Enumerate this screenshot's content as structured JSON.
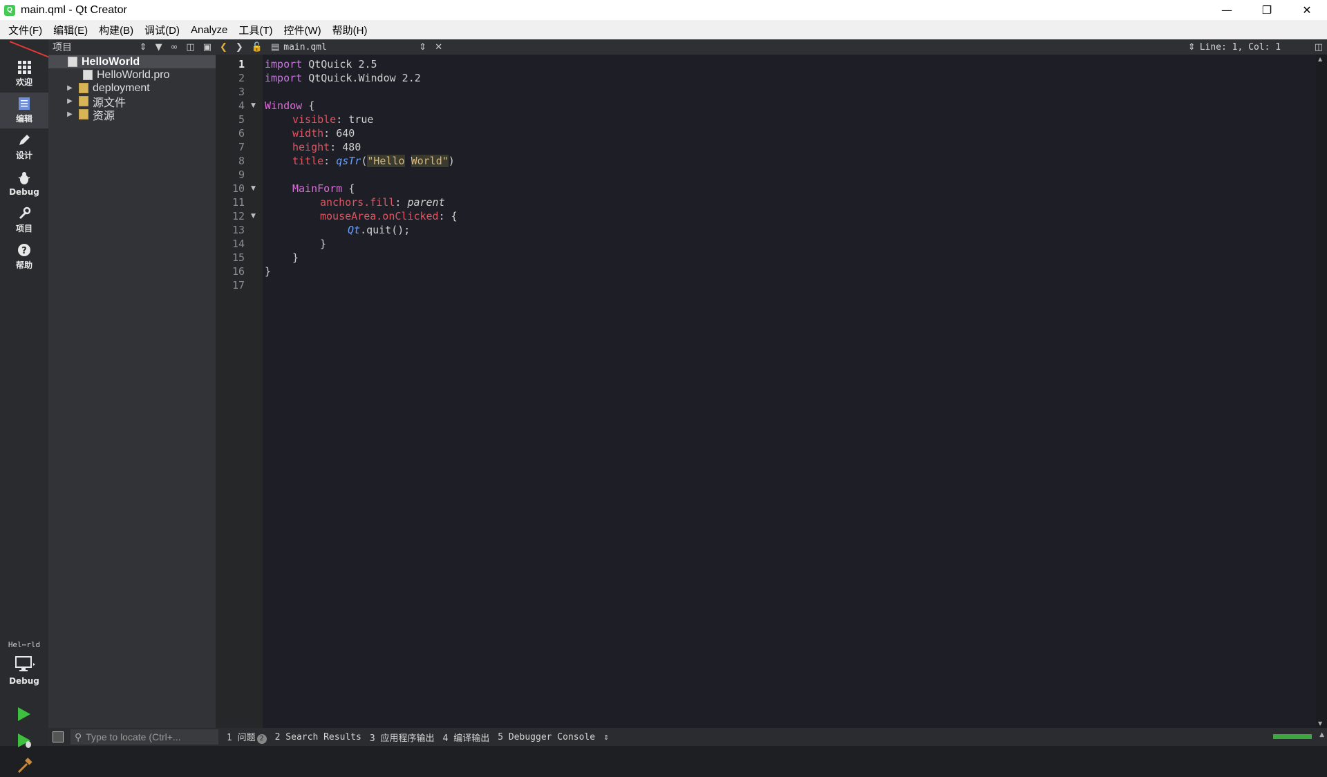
{
  "window": {
    "title": "main.qml - Qt Creator",
    "icon": "qt-logo-icon"
  },
  "menu": [
    "文件(F)",
    "编辑(E)",
    "构建(B)",
    "调试(D)",
    "Analyze",
    "工具(T)",
    "控件(W)",
    "帮助(H)"
  ],
  "modes": [
    {
      "label": "欢迎",
      "icon": "grid-icon"
    },
    {
      "label": "编辑",
      "icon": "document-icon"
    },
    {
      "label": "设计",
      "icon": "pencil-icon"
    },
    {
      "label": "Debug",
      "icon": "bug-icon"
    },
    {
      "label": "项目",
      "icon": "wrench-icon"
    },
    {
      "label": "帮助",
      "icon": "question-icon"
    }
  ],
  "kit": {
    "project": "Hel⋯rld",
    "mode": "Debug"
  },
  "project_panel": {
    "header": "项目"
  },
  "tree": [
    {
      "label": "HelloWorld",
      "selected": true
    },
    {
      "label": "HelloWorld.pro"
    },
    {
      "label": "deployment"
    },
    {
      "label": "源文件"
    },
    {
      "label": "资源"
    }
  ],
  "editor": {
    "file": "main.qml",
    "cursor": "Line: 1, Col: 1",
    "line_numbers": [
      "1",
      "2",
      "3",
      "4",
      "5",
      "6",
      "7",
      "8",
      "9",
      "10",
      "11",
      "12",
      "13",
      "14",
      "15",
      "16",
      "17"
    ],
    "code": {
      "l1_kw": "import",
      "l1_rest": " QtQuick 2.5",
      "l2_kw": "import",
      "l2_rest": " QtQuick.Window 2.2",
      "l4_type": "Window",
      "l4_rest": " {",
      "l5_prop": "visible",
      "l5_rest": ": true",
      "l6_prop": "width",
      "l6_rest": ": 640",
      "l7_prop": "height",
      "l7_rest": ": 480",
      "l8_prop": "title",
      "l8_colon": ": ",
      "l8_fn": "qsTr",
      "l8_open": "(",
      "l8_str1": "\"Hello",
      "l8_space": " ",
      "l8_str2": "World\"",
      "l8_close": ")",
      "l10_type": "MainForm",
      "l10_rest": " {",
      "l11_prop": "anchors.fill",
      "l11_colon": ": ",
      "l11_val": "parent",
      "l12_prop": "mouseArea.onClicked",
      "l12_rest": ": {",
      "l13_fn": "Qt",
      "l13_rest": ".quit();",
      "l14": "}",
      "l15": "}",
      "l16": "}"
    }
  },
  "statusbar": {
    "locator_placeholder": "Type to locate (Ctrl+...",
    "tabs": [
      "1 问题",
      "2 Search Results",
      "3 应用程序输出",
      "4 编译输出",
      "5 Debugger Console"
    ],
    "issue_count": "2"
  }
}
